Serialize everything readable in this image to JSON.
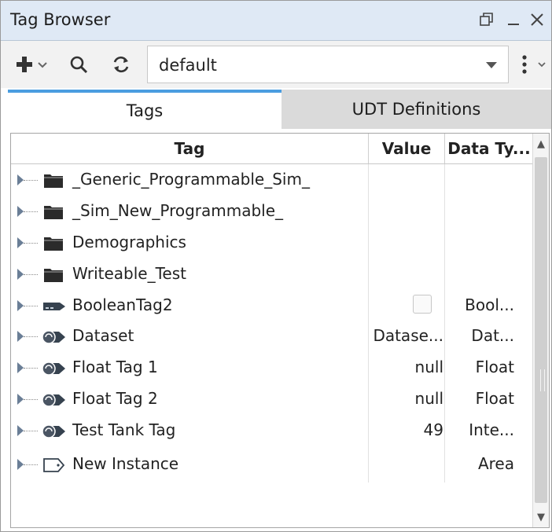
{
  "window": {
    "title": "Tag Browser"
  },
  "toolbar": {
    "add_icon": "plus-icon",
    "search_icon": "search-icon",
    "refresh_icon": "refresh-icon",
    "menu_icon": "kebab-menu-icon",
    "provider_value": "default"
  },
  "tabs": [
    {
      "label": "Tags",
      "active": true
    },
    {
      "label": "UDT Definitions",
      "active": false
    }
  ],
  "table": {
    "columns": [
      "Tag",
      "Value",
      "Data Ty..."
    ],
    "rows": [
      {
        "icon": "folder-icon",
        "name": "_Generic_Programmable_Sim_",
        "value": "",
        "type": ""
      },
      {
        "icon": "folder-icon",
        "name": "_Sim_New_Programmable_",
        "value": "",
        "type": ""
      },
      {
        "icon": "folder-icon",
        "name": "Demographics",
        "value": "",
        "type": ""
      },
      {
        "icon": "folder-icon",
        "name": "Writeable_Test",
        "value": "",
        "type": ""
      },
      {
        "icon": "memory-tag-icon",
        "name": "BooleanTag2",
        "value": "",
        "checkbox": true,
        "type": "Bool..."
      },
      {
        "icon": "opc-tag-icon",
        "name": "Dataset",
        "value": "Datase...",
        "type": "Dat..."
      },
      {
        "icon": "opc-tag-icon",
        "name": "Float Tag 1",
        "value": "null",
        "type": "Float"
      },
      {
        "icon": "opc-tag-icon",
        "name": "Float Tag 2",
        "value": "null",
        "type": "Float"
      },
      {
        "icon": "opc-tag-icon",
        "name": "Test Tank Tag",
        "value": "49",
        "type": "Inte..."
      },
      {
        "icon": "udt-instance-icon",
        "name": "New Instance",
        "value": "",
        "type": "Area"
      }
    ]
  },
  "colors": {
    "title_bg": "#dfe9f5",
    "tab_accent": "#4a9de0",
    "folder": "#2b2b2b"
  }
}
